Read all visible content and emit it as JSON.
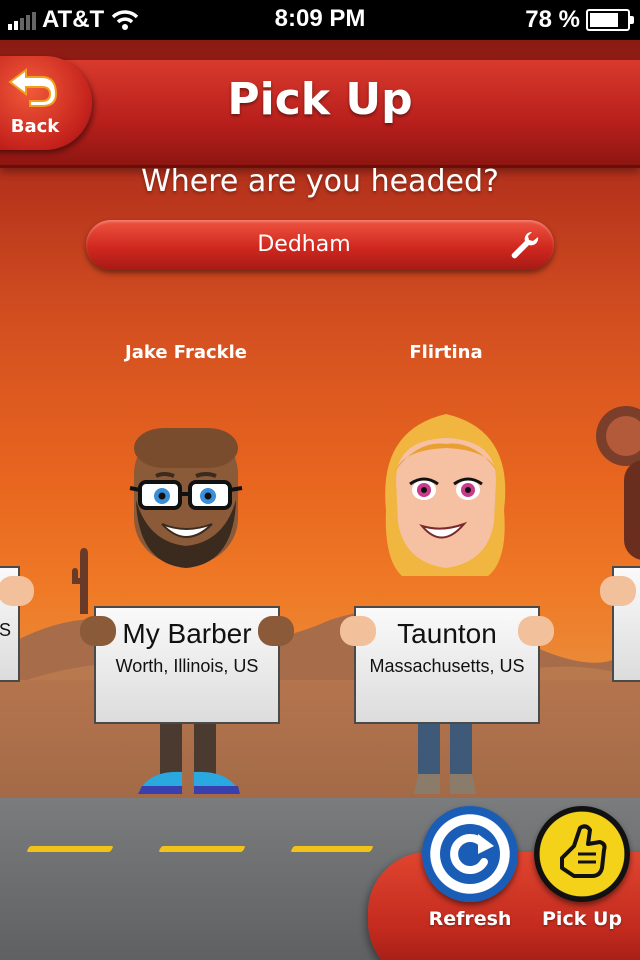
{
  "status_bar": {
    "carrier": "AT&T",
    "time": "8:09 PM",
    "battery_percent": "78 %",
    "battery_level": 0.78
  },
  "header": {
    "title": "Pick Up",
    "back_label": "Back"
  },
  "prompt": "Where are you headed?",
  "destination": {
    "value": "Dedham",
    "icon": "wrench-icon"
  },
  "riders": [
    {
      "name": "",
      "sign_title": "",
      "sign_sub": "S"
    },
    {
      "name": "Jake Frackle",
      "sign_title": "My Barber",
      "sign_sub": "Worth, Illinois, US"
    },
    {
      "name": "Flirtina",
      "sign_title": "Taunton",
      "sign_sub": "Massachusetts, US"
    },
    {
      "name": "",
      "sign_title": "",
      "sign_sub": ""
    }
  ],
  "actions": {
    "refresh_label": "Refresh",
    "pickup_label": "Pick Up"
  },
  "colors": {
    "accent_red": "#c4221c",
    "refresh_blue": "#1a5db6",
    "pickup_yellow": "#f5d21a"
  }
}
